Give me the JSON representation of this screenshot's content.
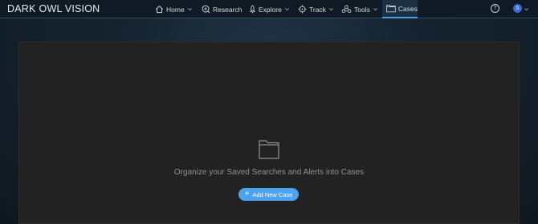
{
  "brand": {
    "logo_left": "DARK",
    "logo_right": "OWL VISION"
  },
  "nav": {
    "home": "Home",
    "research": "Research",
    "explore": "Explore",
    "track": "Track",
    "tools": "Tools",
    "cases": "Cases"
  },
  "header_right": {
    "help": "?",
    "avatar_initial": "S"
  },
  "main": {
    "empty_message": "Organize your Saved Searches and Alerts into Cases",
    "add_button": "Add New Case"
  },
  "colors": {
    "accent": "#4da3f0",
    "panel": "#222222",
    "navbar": "#0f1a24"
  }
}
